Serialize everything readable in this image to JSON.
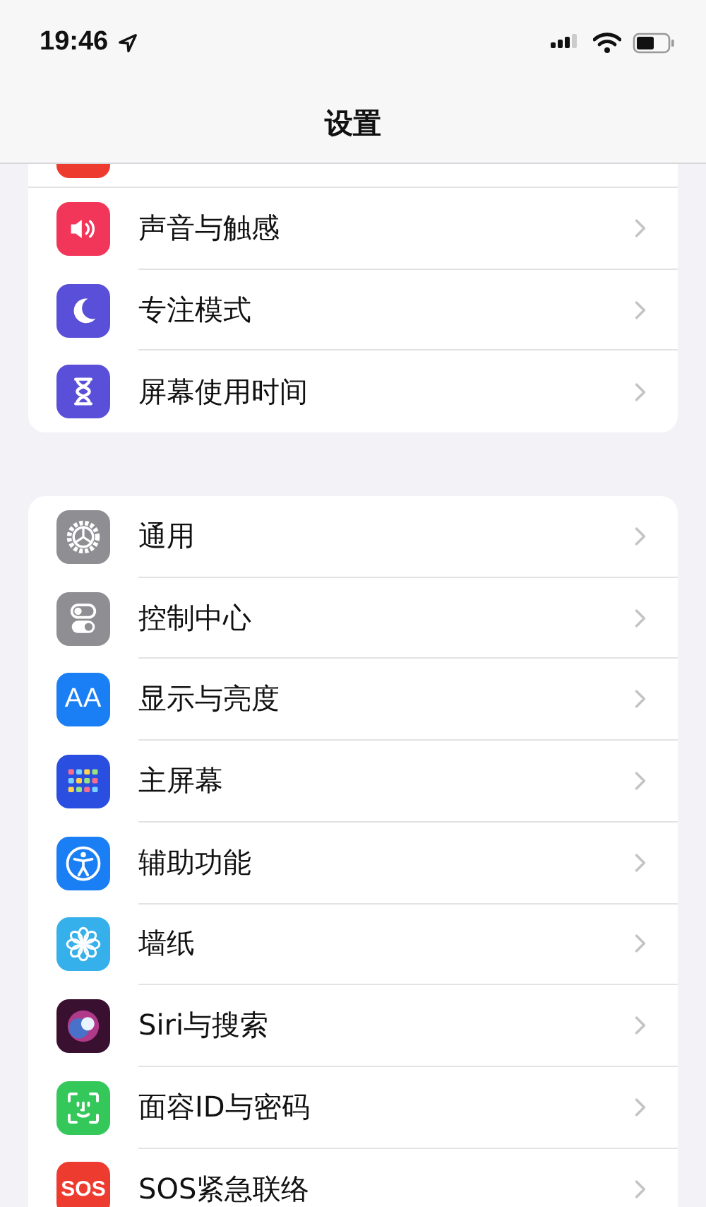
{
  "status_bar": {
    "time": "19:46"
  },
  "header": {
    "title": "设置"
  },
  "groups": [
    {
      "items": [
        {
          "kind": "cut"
        },
        {
          "kind": "sound",
          "label": "声音与触感"
        },
        {
          "kind": "focus",
          "label": "专注模式"
        },
        {
          "kind": "screentime",
          "label": "屏幕使用时间"
        }
      ]
    },
    {
      "items": [
        {
          "kind": "general",
          "label": "通用"
        },
        {
          "kind": "control",
          "label": "控制中心"
        },
        {
          "kind": "display",
          "label": "显示与亮度",
          "icon_text": "AA"
        },
        {
          "kind": "home",
          "label": "主屏幕"
        },
        {
          "kind": "access",
          "label": "辅助功能"
        },
        {
          "kind": "wallpaper",
          "label": "墙纸"
        },
        {
          "kind": "siri",
          "label": "Siri与搜索"
        },
        {
          "kind": "faceid",
          "label": "面容ID与密码"
        },
        {
          "kind": "sos",
          "label": "SOS紧急联络",
          "icon_text": "SOS"
        }
      ]
    }
  ]
}
